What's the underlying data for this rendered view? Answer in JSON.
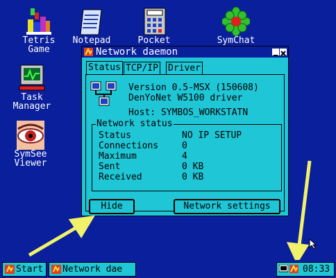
{
  "desktop": {
    "icons": [
      {
        "label_lines": [
          "Tetris",
          "Game"
        ],
        "icon": "tetris-icon"
      },
      {
        "label_lines": [
          "Notepad"
        ],
        "icon": "notepad-icon"
      },
      {
        "label_lines": [
          "Pocket"
        ],
        "icon": "calculator-icon"
      },
      {
        "label_lines": [
          "SymChat"
        ],
        "icon": "symchat-flower-icon"
      },
      {
        "label_lines": [
          "Task",
          "Manager"
        ],
        "icon": "task-manager-monitor-icon"
      },
      {
        "label_lines": [
          "SymSee",
          "Viewer"
        ],
        "icon": "eye-icon"
      }
    ]
  },
  "window": {
    "title": "Network daemon",
    "tabs": [
      "Status",
      "TCP/IP",
      "Driver"
    ],
    "active_tab": "Status",
    "version_line": "Version 0.5-MSX (150608)",
    "driver_line": "DenYoNet W5100 driver",
    "host_line": "Host: SYMBOS_WORKSTATN",
    "group_title": "Network status",
    "stats": [
      {
        "label": "Status",
        "value": "NO IP SETUP"
      },
      {
        "label": "Connections",
        "value": "0"
      },
      {
        "label": "Maximum",
        "value": "4"
      },
      {
        "label": "Sent",
        "value": "0 KB"
      },
      {
        "label": "Received",
        "value": "0 KB"
      }
    ],
    "hide_button": "Hide",
    "settings_button": "Network settings"
  },
  "taskbar": {
    "start_label": "Start",
    "task_label": "Network dae",
    "clock": "08:33"
  },
  "colors": {
    "desktop": "#0a1f9c",
    "window_body": "#1fc6d6",
    "arrow": "#f2f26a"
  }
}
